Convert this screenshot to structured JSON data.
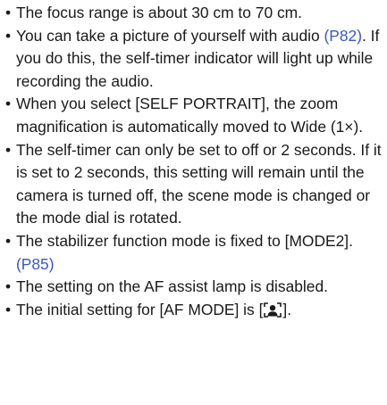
{
  "bullet_symbol": "•",
  "items": [
    {
      "text": "The focus range is about 30 cm to 70 cm."
    },
    {
      "text_before": "You can take a picture of yourself with audio ",
      "link": "(P82)",
      "text_after": ". If you do this, the self-timer indicator will light up while recording the audio."
    },
    {
      "text": "When you select [SELF PORTRAIT], the zoom magnification is automatically moved to Wide (1×)."
    },
    {
      "text": "The self-timer can only be set to off or 2 seconds. If it is set to 2 seconds, this setting will remain until the camera is turned off, the scene mode is changed or the mode dial is rotated."
    },
    {
      "text_before": "The stabilizer function mode is fixed to [MODE2]. ",
      "link": "(P85)"
    },
    {
      "text": "The setting on the AF assist lamp is disabled."
    },
    {
      "text_before": "The initial setting for [AF MODE] is [",
      "icon": "face-detection-icon",
      "text_after": "]."
    }
  ],
  "colors": {
    "text": "#1a1a1a",
    "link": "#3a57c9"
  }
}
